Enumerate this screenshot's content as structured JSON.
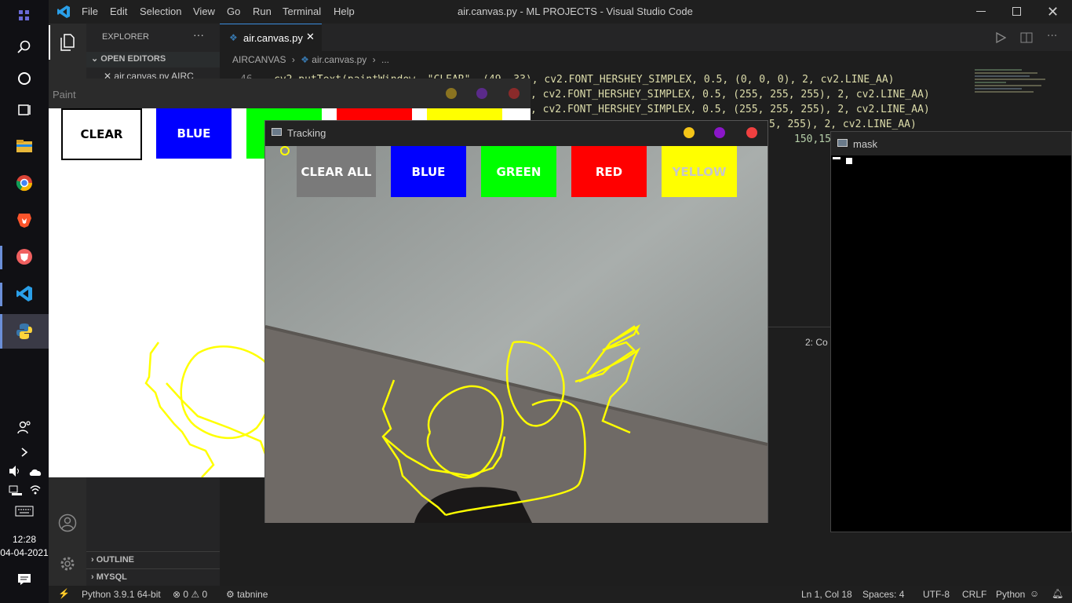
{
  "vscode": {
    "title": "air.canvas.py - ML PROJECTS - Visual Studio Code",
    "menu": [
      "File",
      "Edit",
      "Selection",
      "View",
      "Go",
      "Run",
      "Terminal",
      "Help"
    ],
    "explorer_label": "EXPLORER",
    "open_editors_label": "OPEN EDITORS",
    "open_file_entry": "air.canvas.py  AIRC",
    "outline_label": "OUTLINE",
    "mysql_label": "MYSQL",
    "tab_label": "air.canvas.py",
    "breadcrumb_folder": "AIRCANVAS",
    "breadcrumb_file": "air.canvas.py",
    "breadcrumb_more": "...",
    "code_lines": [
      "cv2.putText(paintWindow, \"CLEAR\", (49, 33), cv2.FONT_HERSHEY_SIMPLEX, 0.5, (0, 0, 0), 2, cv2.LINE_AA)",
      ", cv2.FONT_HERSHEY_SIMPLEX, 0.5, (255, 255, 255), 2, cv2.LINE_AA)",
      ", cv2.FONT_HERSHEY_SIMPLEX, 0.5, (255, 255, 255), 2, cv2.LINE_AA)",
      "5, 255), 2, cv2.LINE_AA)",
      "150,150),"
    ],
    "line_number": "46",
    "panel_label": "2: Co",
    "status": {
      "python": "Python 3.9.1 64-bit",
      "problems": "⊗ 0 ⚠ 0",
      "tabnine": "tabnine",
      "position": "Ln 1, Col 18",
      "spaces": "Spaces: 4",
      "encoding": "UTF-8",
      "eol": "CRLF",
      "language": "Python"
    }
  },
  "taskbar": {
    "time": "12:28",
    "date": "04-04-2021"
  },
  "paint_window": {
    "title": "Paint",
    "buttons": [
      "CLEAR",
      "BLUE"
    ]
  },
  "tracking_window": {
    "title": "Tracking",
    "buttons": [
      "CLEAR ALL",
      "BLUE",
      "GREEN",
      "RED",
      "YELLOW"
    ]
  },
  "mask_window": {
    "title": "mask"
  },
  "colors": {
    "blue": "#0000ff",
    "green": "#00ff00",
    "red": "#ff0000",
    "yellow": "#ffff00",
    "gray": "#7a7a7a",
    "vscode_accent": "#3c8dde"
  },
  "icons": [
    "search-icon",
    "windows-icon",
    "folder-icon",
    "chrome-icon",
    "brave-icon",
    "vscode-icon",
    "python-icon",
    "gear-icon",
    "account-icon",
    "explorer-icon",
    "close-icon",
    "minimize-icon",
    "maximize-icon",
    "run-icon",
    "split-icon"
  ]
}
